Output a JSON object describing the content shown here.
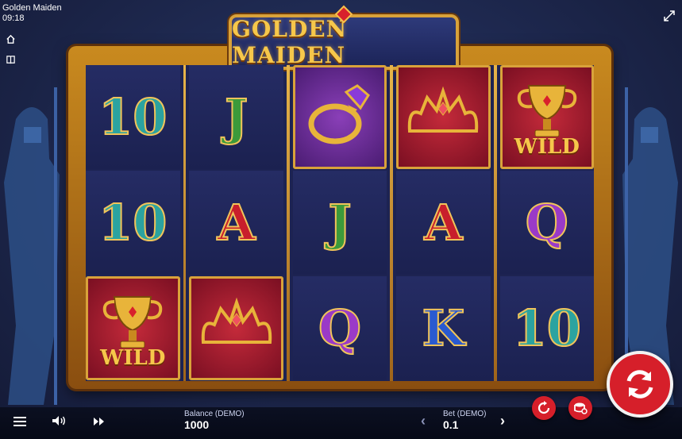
{
  "window": {
    "title": "Golden Maiden",
    "time": "09:18"
  },
  "game": {
    "logo": "GOLDEN MAIDEN"
  },
  "reels": [
    [
      {
        "symbol": "10",
        "color": "teal",
        "bg": "plain",
        "wild": false
      },
      {
        "symbol": "10",
        "color": "teal",
        "bg": "plain",
        "wild": false
      },
      {
        "symbol": "trophy",
        "color": "gold",
        "bg": "red",
        "wild": true
      }
    ],
    [
      {
        "symbol": "J",
        "color": "green",
        "bg": "plain",
        "wild": false
      },
      {
        "symbol": "A",
        "color": "red",
        "bg": "plain",
        "wild": false
      },
      {
        "symbol": "crown",
        "color": "gold",
        "bg": "red",
        "wild": false
      }
    ],
    [
      {
        "symbol": "ring",
        "color": "gold",
        "bg": "purple",
        "wild": false
      },
      {
        "symbol": "J",
        "color": "green",
        "bg": "plain",
        "wild": false
      },
      {
        "symbol": "Q",
        "color": "purple",
        "bg": "plain",
        "wild": false
      }
    ],
    [
      {
        "symbol": "crown",
        "color": "gold",
        "bg": "red",
        "wild": false
      },
      {
        "symbol": "A",
        "color": "red",
        "bg": "plain",
        "wild": false
      },
      {
        "symbol": "K",
        "color": "blue",
        "bg": "plain",
        "wild": false
      }
    ],
    [
      {
        "symbol": "trophy",
        "color": "gold",
        "bg": "red",
        "wild": true
      },
      {
        "symbol": "Q",
        "color": "purple",
        "bg": "plain",
        "wild": false
      },
      {
        "symbol": "10",
        "color": "teal",
        "bg": "plain",
        "wild": false
      }
    ]
  ],
  "wild_label": "WILD",
  "bottom_bar": {
    "balance_label": "Balance (DEMO)",
    "balance_value": "1000",
    "bet_label": "Bet (DEMO)",
    "bet_value": "0.1",
    "bet_prev_icon": "chevron-left-icon",
    "bet_next_icon": "chevron-right-icon"
  },
  "icons": [
    "home-icon",
    "book-icon",
    "expand-icon",
    "menu-icon",
    "sound-icon",
    "fast-forward-icon",
    "autoplay-icon",
    "bet-settings-icon",
    "spin-icon"
  ],
  "colors": {
    "spin": "#d61f2a",
    "gold": "#f6c74b",
    "frame": "#c98a1f"
  }
}
